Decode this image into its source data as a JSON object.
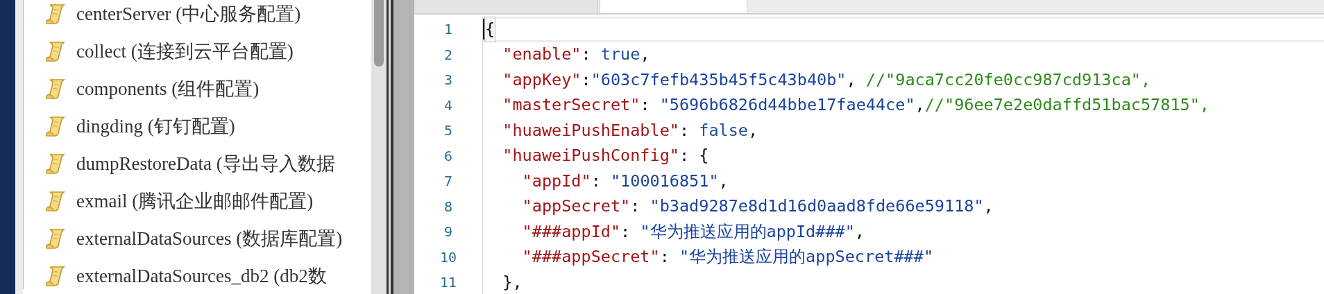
{
  "sidebar": {
    "items": [
      {
        "label": "centerServer (中心服务配置)"
      },
      {
        "label": "collect (连接到云平台配置)"
      },
      {
        "label": "components (组件配置)"
      },
      {
        "label": "dingding (钉钉配置)"
      },
      {
        "label": "dumpRestoreData (导出导入数据"
      },
      {
        "label": "exmail (腾讯企业邮邮件配置)"
      },
      {
        "label": "externalDataSources (数据库配置)"
      },
      {
        "label": "externalDataSources_db2 (db2数"
      }
    ]
  },
  "tabs": [
    {
      "selected": false
    },
    {
      "selected": true
    }
  ],
  "editor": {
    "lines": [
      {
        "number": "1",
        "active": true,
        "tokens": [
          {
            "kind": "bracket",
            "text": "{"
          }
        ]
      },
      {
        "number": "2",
        "active": false,
        "tokens": [
          {
            "kind": "key",
            "text": "  \"enable\""
          },
          {
            "kind": "punct",
            "text": ": "
          },
          {
            "kind": "keyword",
            "text": "true"
          },
          {
            "kind": "punct",
            "text": ","
          }
        ]
      },
      {
        "number": "3",
        "active": false,
        "tokens": [
          {
            "kind": "key",
            "text": "  \"appKey\""
          },
          {
            "kind": "punct",
            "text": ":"
          },
          {
            "kind": "string",
            "text": "\"603c7fefb435b45f5c43b40b\""
          },
          {
            "kind": "punct",
            "text": ", "
          },
          {
            "kind": "comment",
            "text": "//\"9aca7cc20fe0cc987cd913ca\","
          }
        ]
      },
      {
        "number": "4",
        "active": false,
        "tokens": [
          {
            "kind": "key",
            "text": "  \"masterSecret\""
          },
          {
            "kind": "punct",
            "text": ": "
          },
          {
            "kind": "string",
            "text": "\"5696b6826d44bbe17fae44ce\""
          },
          {
            "kind": "punct",
            "text": ","
          },
          {
            "kind": "comment",
            "text": "//\"96ee7e2e0daffd51bac57815\","
          }
        ]
      },
      {
        "number": "5",
        "active": false,
        "tokens": [
          {
            "kind": "key",
            "text": "  \"huaweiPushEnable\""
          },
          {
            "kind": "punct",
            "text": ": "
          },
          {
            "kind": "keyword",
            "text": "false"
          },
          {
            "kind": "punct",
            "text": ","
          }
        ]
      },
      {
        "number": "6",
        "active": false,
        "tokens": [
          {
            "kind": "key",
            "text": "  \"huaweiPushConfig\""
          },
          {
            "kind": "punct",
            "text": ": {"
          }
        ]
      },
      {
        "number": "7",
        "active": false,
        "tokens": [
          {
            "kind": "key",
            "text": "    \"appId\""
          },
          {
            "kind": "punct",
            "text": ": "
          },
          {
            "kind": "string",
            "text": "\"100016851\""
          },
          {
            "kind": "punct",
            "text": ","
          }
        ]
      },
      {
        "number": "8",
        "active": false,
        "tokens": [
          {
            "kind": "key",
            "text": "    \"appSecret\""
          },
          {
            "kind": "punct",
            "text": ": "
          },
          {
            "kind": "string",
            "text": "\"b3ad9287e8d1d16d0aad8fde66e59118\""
          },
          {
            "kind": "punct",
            "text": ","
          }
        ]
      },
      {
        "number": "9",
        "active": false,
        "tokens": [
          {
            "kind": "key",
            "text": "    \"###appId\""
          },
          {
            "kind": "punct",
            "text": ": "
          },
          {
            "kind": "string",
            "text": "\"华为推送应用的appId###\""
          },
          {
            "kind": "punct",
            "text": ","
          }
        ]
      },
      {
        "number": "10",
        "active": false,
        "tokens": [
          {
            "kind": "key",
            "text": "    \"###appSecret\""
          },
          {
            "kind": "punct",
            "text": ": "
          },
          {
            "kind": "string",
            "text": "\"华为推送应用的appSecret###\""
          }
        ]
      },
      {
        "number": "11",
        "active": false,
        "tokens": [
          {
            "kind": "punct",
            "text": "  },"
          }
        ]
      }
    ]
  }
}
